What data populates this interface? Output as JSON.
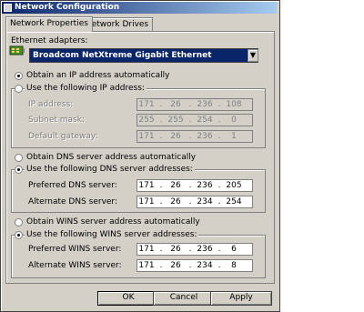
{
  "window": {
    "title": "Network Configuration"
  },
  "tabs": [
    {
      "label": "Network Properties"
    },
    {
      "label": "Network Drives"
    }
  ],
  "adapter": {
    "label": "Ethernet adapters:",
    "selected": "Broadcom NetXtreme Gigabit Ethernet"
  },
  "ip": {
    "auto_label": "Obtain an IP address automatically",
    "manual_label": "Use the following IP address:",
    "fields": [
      {
        "label": "IP address:",
        "octets": [
          "171",
          "26",
          "236",
          "108"
        ]
      },
      {
        "label": "Subnet mask:",
        "octets": [
          "255",
          "255",
          "254",
          "0"
        ]
      },
      {
        "label": "Default gateway:",
        "octets": [
          "171",
          "26",
          "236",
          "1"
        ]
      }
    ]
  },
  "dns": {
    "auto_label": "Obtain DNS server address automatically",
    "manual_label": "Use the following DNS server addresses:",
    "fields": [
      {
        "label": "Preferred DNS server:",
        "octets": [
          "171",
          "26",
          "236",
          "205"
        ]
      },
      {
        "label": "Alternate DNS server:",
        "octets": [
          "171",
          "26",
          "234",
          "254"
        ]
      }
    ]
  },
  "wins": {
    "auto_label": "Obtain WINS server address automatically",
    "manual_label": "Use the following WINS server addresses:",
    "fields": [
      {
        "label": "Preferred WINS server:",
        "octets": [
          "171",
          "26",
          "236",
          "6"
        ]
      },
      {
        "label": "Alternate WINS server:",
        "octets": [
          "171",
          "26",
          "234",
          "8"
        ]
      }
    ]
  },
  "buttons": {
    "ok": "OK",
    "cancel": "Cancel",
    "apply": "Apply"
  }
}
